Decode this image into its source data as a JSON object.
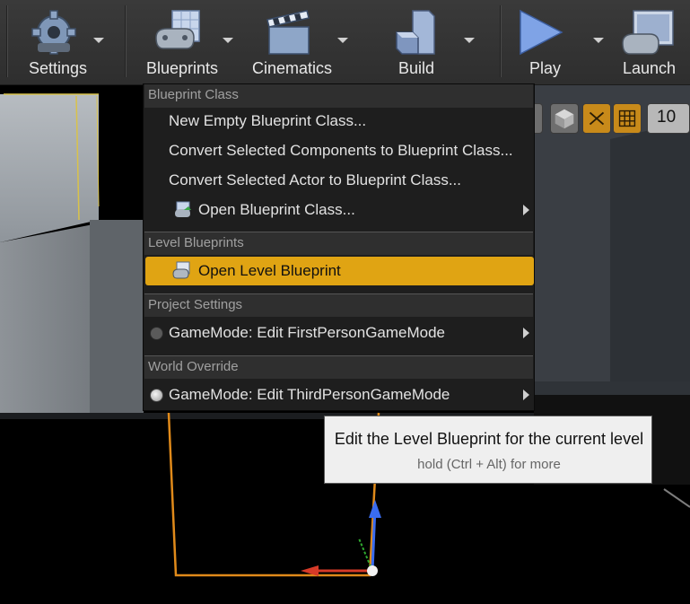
{
  "toolbar": {
    "buttons": [
      {
        "label": "Settings",
        "icon": "gear-icon"
      },
      {
        "label": "Blueprints",
        "icon": "blueprint-gamepad-icon"
      },
      {
        "label": "Cinematics",
        "icon": "clapperboard-icon"
      },
      {
        "label": "Build",
        "icon": "build-blocks-icon"
      },
      {
        "label": "Play",
        "icon": "play-icon"
      },
      {
        "label": "Launch",
        "icon": "launch-monitor-icon"
      }
    ]
  },
  "viewport": {
    "controls": {
      "grid_size_label": "10"
    }
  },
  "menu": {
    "sections": [
      {
        "title": "Blueprint Class",
        "items": [
          {
            "label": "New Empty Blueprint Class..."
          },
          {
            "label": "Convert Selected Components to Blueprint Class..."
          },
          {
            "label": "Convert Selected Actor to Blueprint Class..."
          },
          {
            "label": "Open Blueprint Class...",
            "icon": "blueprint-open-icon",
            "submenu": true
          }
        ]
      },
      {
        "title": "Level Blueprints",
        "items": [
          {
            "label": "Open Level Blueprint",
            "icon": "level-blueprint-icon",
            "highlighted": true
          }
        ]
      },
      {
        "title": "Project Settings",
        "items": [
          {
            "label": "GameMode: Edit FirstPersonGameMode",
            "icon": "gamemode-dot-icon",
            "submenu": true
          }
        ]
      },
      {
        "title": "World Override",
        "items": [
          {
            "label": "GameMode: Edit ThirdPersonGameMode",
            "icon": "gamemode-dot-icon",
            "submenu": true
          }
        ]
      }
    ]
  },
  "tooltip": {
    "text": "Edit the Level Blueprint for the current level",
    "hint": "hold (Ctrl + Alt) for more"
  },
  "colors": {
    "highlight": "#e0a413",
    "menu_bg": "#1e1e1e",
    "section_bg": "#2f2f2f",
    "toolbar_bg": "#333333",
    "selection_orange": "#e08a1a",
    "gizmo_blue": "#3a6cf0"
  }
}
